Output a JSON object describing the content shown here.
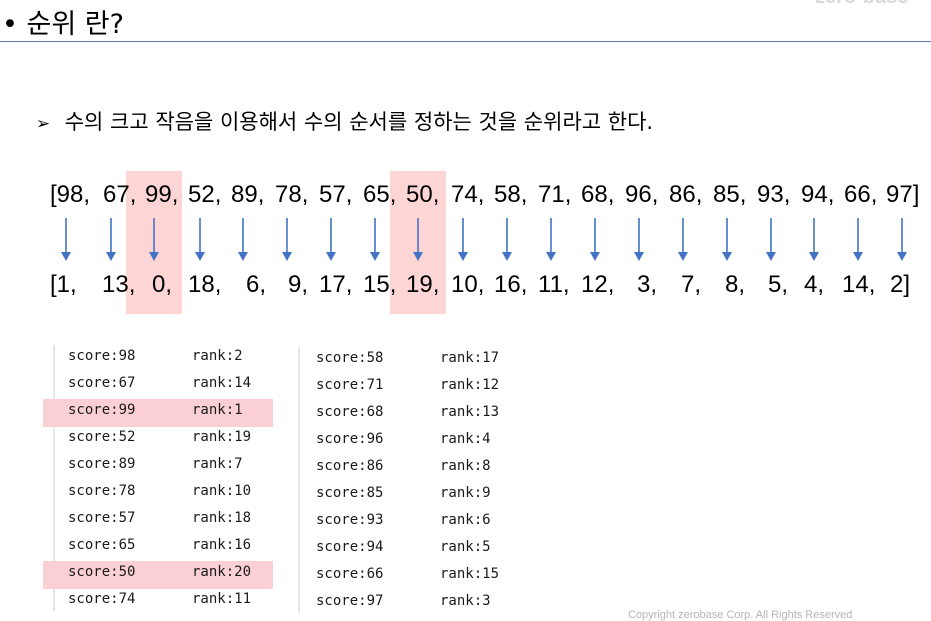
{
  "header": {
    "title": "• 순위 란?",
    "brand": "zero-base"
  },
  "bullet": {
    "mark": "➢",
    "text": "수의 크고 작음을 이용해서 수의 순서를 정하는 것을 순위라고 한다."
  },
  "sequence": {
    "scores": [
      "[98,",
      "67,",
      "99,",
      "52,",
      "89,",
      "78,",
      "57,",
      "65,",
      "50,",
      "74,",
      "58,",
      "71,",
      "68,",
      "96,",
      "86,",
      "85,",
      "93,",
      "94,",
      "66,",
      "97]"
    ],
    "ranks": [
      "[1,",
      "13,",
      "0,",
      "18,",
      "6,",
      "9,",
      "17,",
      "15,",
      "19,",
      "10,",
      "16,",
      "11,",
      "12,",
      "3,",
      "7,",
      "8,",
      "5,",
      "4,",
      "14,",
      "2]"
    ],
    "highlighted_indices": [
      2,
      8
    ]
  },
  "terminal": {
    "left": [
      {
        "score": "score:98",
        "rank": "rank:2"
      },
      {
        "score": "score:67",
        "rank": "rank:14"
      },
      {
        "score": "score:99",
        "rank": "rank:1"
      },
      {
        "score": "score:52",
        "rank": "rank:19"
      },
      {
        "score": "score:89",
        "rank": "rank:7"
      },
      {
        "score": "score:78",
        "rank": "rank:10"
      },
      {
        "score": "score:57",
        "rank": "rank:18"
      },
      {
        "score": "score:65",
        "rank": "rank:16"
      },
      {
        "score": "score:50",
        "rank": "rank:20"
      },
      {
        "score": "score:74",
        "rank": "rank:11"
      }
    ],
    "right": [
      {
        "score": "score:58",
        "rank": "rank:17"
      },
      {
        "score": "score:71",
        "rank": "rank:12"
      },
      {
        "score": "score:68",
        "rank": "rank:13"
      },
      {
        "score": "score:96",
        "rank": "rank:4"
      },
      {
        "score": "score:86",
        "rank": "rank:8"
      },
      {
        "score": "score:85",
        "rank": "rank:9"
      },
      {
        "score": "score:93",
        "rank": "rank:6"
      },
      {
        "score": "score:94",
        "rank": "rank:5"
      },
      {
        "score": "score:66",
        "rank": "rank:15"
      },
      {
        "score": "score:97",
        "rank": "rank:3"
      }
    ],
    "highlighted_left_rows": [
      2,
      8
    ]
  },
  "colors": {
    "highlight": "#fdd5d5",
    "arrow": "#4472c4",
    "rule": "#5b7bb5"
  },
  "footer": {
    "copyright": "Copyright zerobase Corp. All Rights Reserved"
  }
}
